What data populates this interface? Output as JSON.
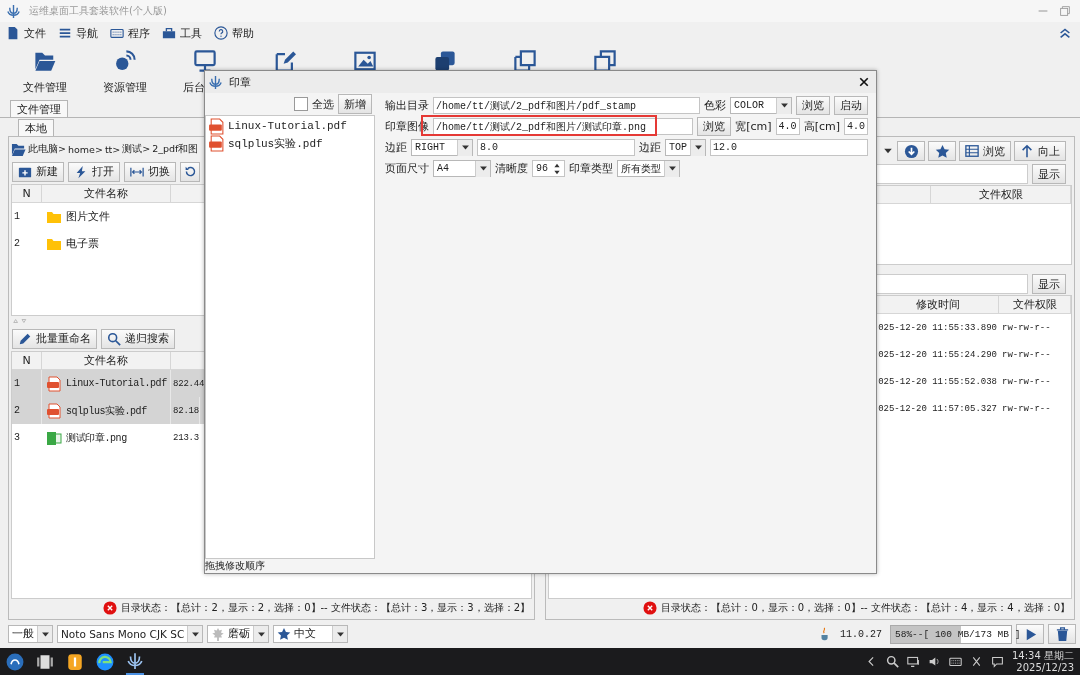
{
  "window": {
    "title": "运维桌面工具套装软件(个人版)"
  },
  "menu": [
    "文件",
    "导航",
    "程序",
    "工具",
    "帮助"
  ],
  "toolbar": [
    {
      "label": "文件管理"
    },
    {
      "label": "资源管理"
    },
    {
      "label": "后台"
    }
  ],
  "main_tab": {
    "label": "文件管理",
    "selected": true
  },
  "left_panel": {
    "tab": {
      "label": "本地",
      "selected": true
    },
    "breadcrumb": [
      "此电脑>",
      "home>",
      "tt>",
      "测试>",
      "2_pdf和图"
    ],
    "buttons": [
      "新建",
      "打开",
      "切换"
    ],
    "folders": {
      "columns": [
        "N",
        "文件名称"
      ],
      "rows": [
        {
          "n": "1",
          "name": "图片文件",
          "selected": false
        },
        {
          "n": "2",
          "name": "电子票",
          "selected": false
        }
      ]
    },
    "actions": [
      "批量重命名",
      "递归搜索"
    ],
    "files": {
      "columns": [
        "N",
        "文件名称"
      ],
      "rows": [
        {
          "n": "1",
          "name": "Linux-Tutorial.pdf",
          "size": "822.44",
          "kind": "pdf",
          "selected": true
        },
        {
          "n": "2",
          "name": "sqlplus实验.pdf",
          "size": "82.18",
          "kind": "pdf",
          "selected": true
        },
        {
          "n": "3",
          "name": "测试印章.png",
          "size": "213.3",
          "kind": "image",
          "selected": false
        }
      ]
    },
    "status": "目录状态：【总计：2，显示：2，选择：0】-- 文件状态：【总计：3，显示：3，选择：2】"
  },
  "right_panel": {
    "buttons": [
      "浏览",
      "向上"
    ],
    "filter_buttons": [
      "显示",
      "显示"
    ],
    "dirs": {
      "columns": [
        "文件权限"
      ]
    },
    "files": {
      "columns": [
        "修改时间",
        "文件权限"
      ],
      "rows": [
        {
          "modified": "025-12-20 11:55:33.890",
          "permissions": "rw-rw-r--"
        },
        {
          "modified": "025-12-20 11:55:24.290",
          "permissions": "rw-rw-r--"
        },
        {
          "modified": "025-12-20 11:55:52.038",
          "permissions": "rw-rw-r--"
        },
        {
          "modified": "025-12-20 11:57:05.327",
          "permissions": "rw-rw-r--"
        }
      ]
    },
    "status": "目录状态：【总计：0，显示：0，选择：0】-- 文件状态：【总计：4，显示：4，选择：0】"
  },
  "bottom_bar": {
    "dropdowns": [
      "一般",
      "Noto Sans Mono CJK SC",
      "磨砺",
      "中文"
    ],
    "java_version": "11.0.27",
    "memory": {
      "reading": "58%--[ 100 MB/173 MB ]",
      "level": 0.58
    }
  },
  "taskbar": {
    "time": "14:34 星期二",
    "date": "2025/12/23"
  },
  "dialog": {
    "title": "印章",
    "select_all": {
      "label": "全选",
      "checked": false
    },
    "add_button": "新增",
    "files": [
      "Linux-Tutorial.pdf",
      "sqlplus实验.pdf"
    ],
    "hint": "拖拽修改顺序",
    "form": [
      [
        {
          "kind": "label",
          "text": "输出目录"
        },
        {
          "kind": "field",
          "value": "/home/tt/测试/2_pdf和图片/pdf_stamp"
        },
        {
          "kind": "label",
          "text": "色彩"
        },
        {
          "kind": "dropdown",
          "value": "COLOR"
        },
        {
          "kind": "button",
          "text": "浏览"
        },
        {
          "kind": "button",
          "text": "启动"
        }
      ],
      [
        {
          "kind": "label",
          "text": "印章图像"
        },
        {
          "kind": "field",
          "value": "/home/tt/测试/2_pdf和图片/测试印章.png",
          "highlighted": true
        },
        {
          "kind": "button",
          "text": "浏览"
        },
        {
          "kind": "label",
          "text": "宽[cm]"
        },
        {
          "kind": "field",
          "value": "4.0"
        },
        {
          "kind": "label",
          "text": "高[cm]"
        },
        {
          "kind": "field",
          "value": "4.0"
        }
      ],
      [
        {
          "kind": "label",
          "text": "边距"
        },
        {
          "kind": "dropdown",
          "value": "RIGHT"
        },
        {
          "kind": "field",
          "value": "8.0"
        },
        {
          "kind": "label",
          "text": "边距"
        },
        {
          "kind": "dropdown",
          "value": "TOP"
        },
        {
          "kind": "field",
          "value": "12.0"
        }
      ],
      [
        {
          "kind": "label",
          "text": "页面尺寸"
        },
        {
          "kind": "dropdown",
          "value": "A4"
        },
        {
          "kind": "label",
          "text": "清晰度"
        },
        {
          "kind": "spinner",
          "value": "96"
        },
        {
          "kind": "label",
          "text": "印章类型"
        },
        {
          "kind": "dropdown",
          "value": "所有类型"
        }
      ]
    ]
  }
}
